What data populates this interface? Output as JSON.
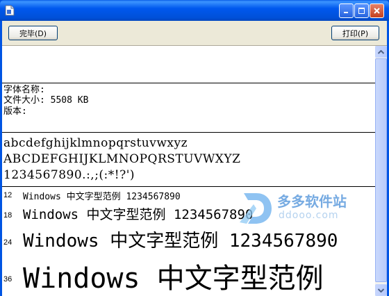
{
  "toolbar": {
    "done_label": "完毕(D)",
    "print_label": "打印(P)"
  },
  "font_info": {
    "name_label": "字体名称:",
    "size_label": "文件大小: 5508 KB",
    "version_label": "版本:"
  },
  "samples": {
    "lowercase": "abcdefghijklmnopqrstuvwxyz",
    "uppercase": "ABCDEFGHIJKLMNOPQRSTUVWXYZ",
    "digits": "1234567890.:,;(:*!?')"
  },
  "size_samples": [
    {
      "size": "12",
      "text": "Windows 中文字型范例 1234567890"
    },
    {
      "size": "18",
      "text": "Windows 中文字型范例 1234567890"
    },
    {
      "size": "24",
      "text": "Windows 中文字型范例 1234567890"
    },
    {
      "size": "36",
      "text": "Windows 中文字型范例"
    }
  ],
  "watermark": {
    "title": "多多软件站",
    "url": "ddooo.com"
  },
  "icons": [
    "app-icon",
    "minimize-icon",
    "maximize-icon",
    "close-icon",
    "scroll-up-icon",
    "scroll-down-icon"
  ]
}
